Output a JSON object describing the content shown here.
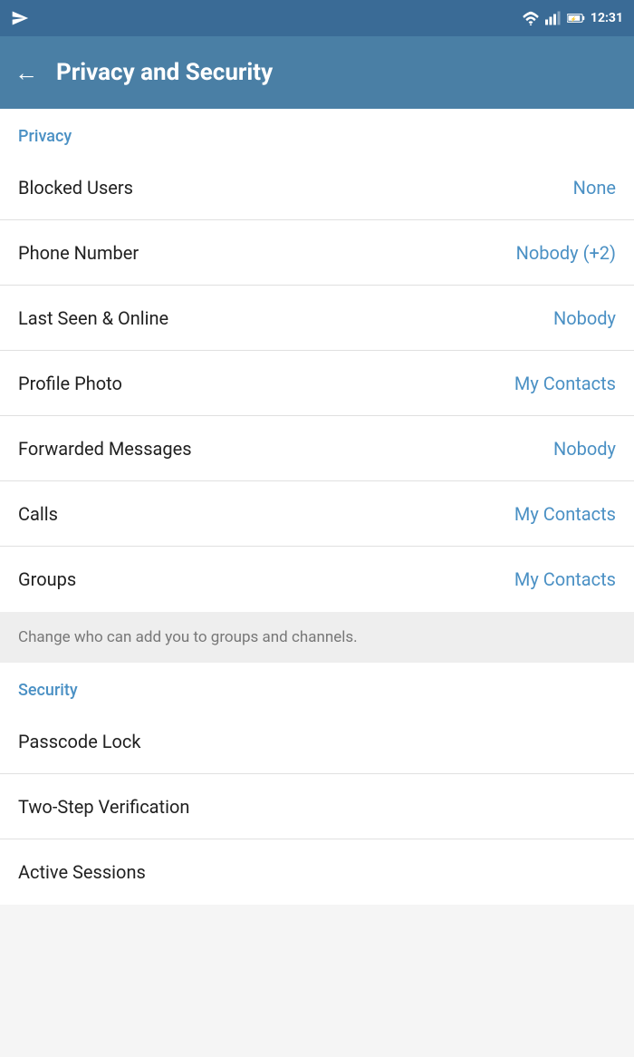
{
  "statusBar": {
    "time": "12:31",
    "sendIconUnicode": "➤"
  },
  "appBar": {
    "backLabel": "←",
    "title": "Privacy and Security"
  },
  "privacy": {
    "sectionLabel": "Privacy",
    "items": [
      {
        "label": "Blocked Users",
        "value": "None"
      },
      {
        "label": "Phone Number",
        "value": "Nobody (+2)"
      },
      {
        "label": "Last Seen & Online",
        "value": "Nobody"
      },
      {
        "label": "Profile Photo",
        "value": "My Contacts"
      },
      {
        "label": "Forwarded Messages",
        "value": "Nobody"
      },
      {
        "label": "Calls",
        "value": "My Contacts"
      },
      {
        "label": "Groups",
        "value": "My Contacts"
      }
    ],
    "groupsNote": "Change who can add you to groups and channels."
  },
  "security": {
    "sectionLabel": "Security",
    "items": [
      {
        "label": "Passcode Lock"
      },
      {
        "label": "Two-Step Verification"
      },
      {
        "label": "Active Sessions"
      }
    ]
  }
}
